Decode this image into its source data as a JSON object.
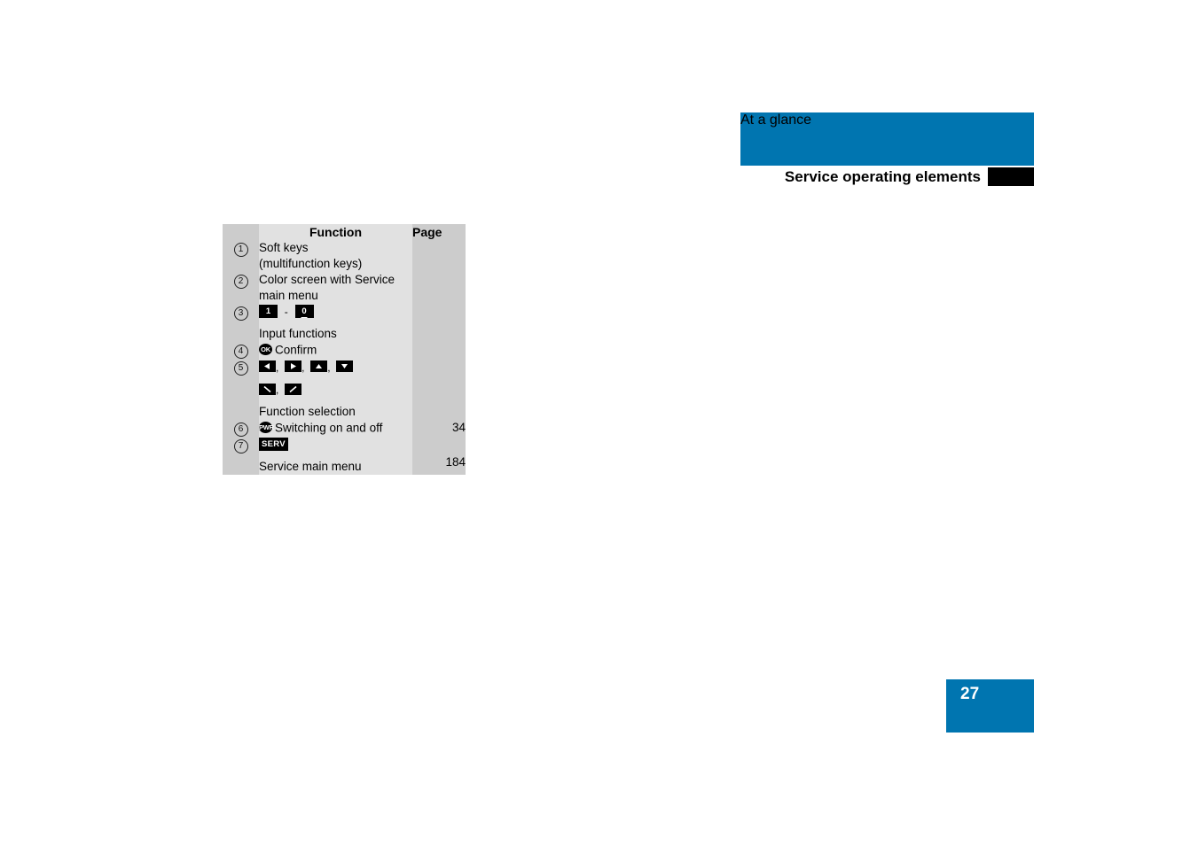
{
  "header": {
    "banner_title": "At a glance",
    "subtitle": "Service operating elements",
    "banner_color": "#0075b0",
    "marker_color": "#000000"
  },
  "table": {
    "columns": {
      "index": "",
      "function": "Function",
      "page": "Page"
    },
    "rows": [
      {
        "index": "1",
        "function_lines": [
          "Soft keys",
          "(multifunction keys)"
        ],
        "page": ""
      },
      {
        "index": "2",
        "function_lines": [
          "Color screen with Service",
          "main menu"
        ],
        "page": ""
      },
      {
        "index": "3",
        "keys": [
          "1",
          "0"
        ],
        "key_separator": "-",
        "function_lines": [
          "Input functions"
        ],
        "page": ""
      },
      {
        "index": "4",
        "icon": "ok-button-icon",
        "icon_label": "OK",
        "function_lines": [
          "Confirm"
        ],
        "page": ""
      },
      {
        "index": "5",
        "arrow_keys_line1": [
          "arrow-left-icon",
          "arrow-right-icon",
          "arrow-up-icon",
          "arrow-down-icon"
        ],
        "arrow_keys_line2": [
          "diagonal-down-right-icon",
          "diagonal-up-right-icon"
        ],
        "function_lines": [
          "Function selection"
        ],
        "page": ""
      },
      {
        "index": "6",
        "icon": "power-button-icon",
        "icon_label": "PWR",
        "function_lines": [
          "Switching on and off"
        ],
        "page": "34"
      },
      {
        "index": "7",
        "badge": "SERV",
        "function_lines": [
          "Service main menu"
        ],
        "page": "184"
      }
    ]
  },
  "footer": {
    "page_number": "27",
    "color": "#0075b0"
  }
}
